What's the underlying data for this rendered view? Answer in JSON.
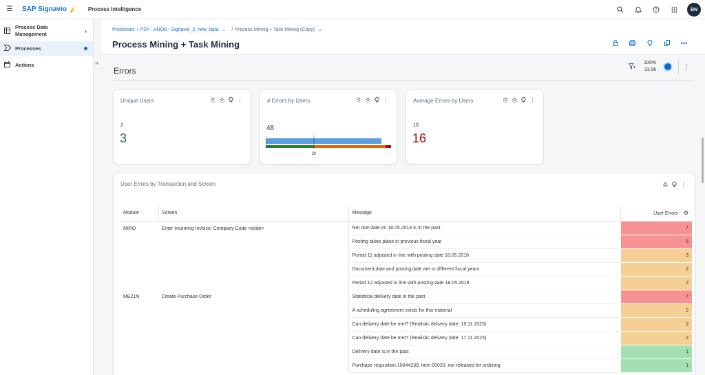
{
  "topbar": {
    "logo_text": "SAP Signavio",
    "product": "Process Intelligence",
    "avatar_initials": "BN"
  },
  "sidebar": {
    "items": [
      {
        "label": "Process Data Management"
      },
      {
        "label": "Processes"
      },
      {
        "label": "Actions"
      }
    ]
  },
  "breadcrumb": {
    "root": "Processes",
    "middle": "P2P - KNOA - Signavio_2_new_data",
    "current": "Process Mining + Task Mining (Copy)"
  },
  "page": {
    "title": "Process Mining + Task Mining"
  },
  "section": {
    "title": "Errors",
    "zoom_percent": "100%",
    "count": "33.9k"
  },
  "cards": {
    "unique_users": {
      "title": "Unique Users",
      "small": "2",
      "big": "3",
      "big_color": "#256f3a"
    },
    "errors_by_users": {
      "title": "# Errors by Users",
      "value": "48",
      "tick": "20",
      "bar_value": 48,
      "axis_max": 52,
      "marker": 20
    },
    "average_errors": {
      "title": "Average Errors by Users",
      "small": "10",
      "big": "16",
      "big_color": "#aa0808"
    }
  },
  "table_card": {
    "title": "User Errors by Transaction and Screen",
    "columns": [
      "Module",
      "Screen",
      "Message",
      "User Errors"
    ],
    "groups": [
      {
        "module": "MIRO",
        "screen": "Enter Incoming Invoice: Company Code <code>",
        "rows": [
          {
            "message": "Net due date on 18.05.2018 is in the past",
            "errors": "7",
            "color": "#f79292"
          },
          {
            "message": "Posting takes place in previous fiscal year",
            "errors": "5",
            "color": "#f79292"
          },
          {
            "message": "Period 11 adjusted in line with posting date 18.05.2018",
            "errors": "3",
            "color": "#f6cf95"
          },
          {
            "message": "Document date and posting date are in different fiscal years",
            "errors": "2",
            "color": "#f6cf95"
          },
          {
            "message": "Period 12 adjusted in line with posting date 18.05.2018",
            "errors": "2",
            "color": "#f6cf95"
          }
        ]
      },
      {
        "module": "ME21N",
        "screen": "Create Purchase Order",
        "rows": [
          {
            "message": "Statistical delivery date in the past",
            "errors": "7",
            "color": "#f79292"
          },
          {
            "message": "A scheduling agreement exists for this material",
            "errors": "2",
            "color": "#f6cf95"
          },
          {
            "message": "Can delivery date be met? (Realistic delivery date: 19.11.2023)",
            "errors": "2",
            "color": "#f6cf95"
          },
          {
            "message": "Can delivery date be met? (Realistic delivery date: 17.11.2023)",
            "errors": "2",
            "color": "#f6cf95"
          },
          {
            "message": "Delivery date is in the past",
            "errors": "1",
            "color": "#a4dfb1"
          },
          {
            "message": "Purchase requisition 10044239, item 00020, not released for ordering",
            "errors": "1",
            "color": "#a4dfb1"
          }
        ]
      }
    ]
  },
  "colors": {
    "accent": "#0a6ed1"
  }
}
